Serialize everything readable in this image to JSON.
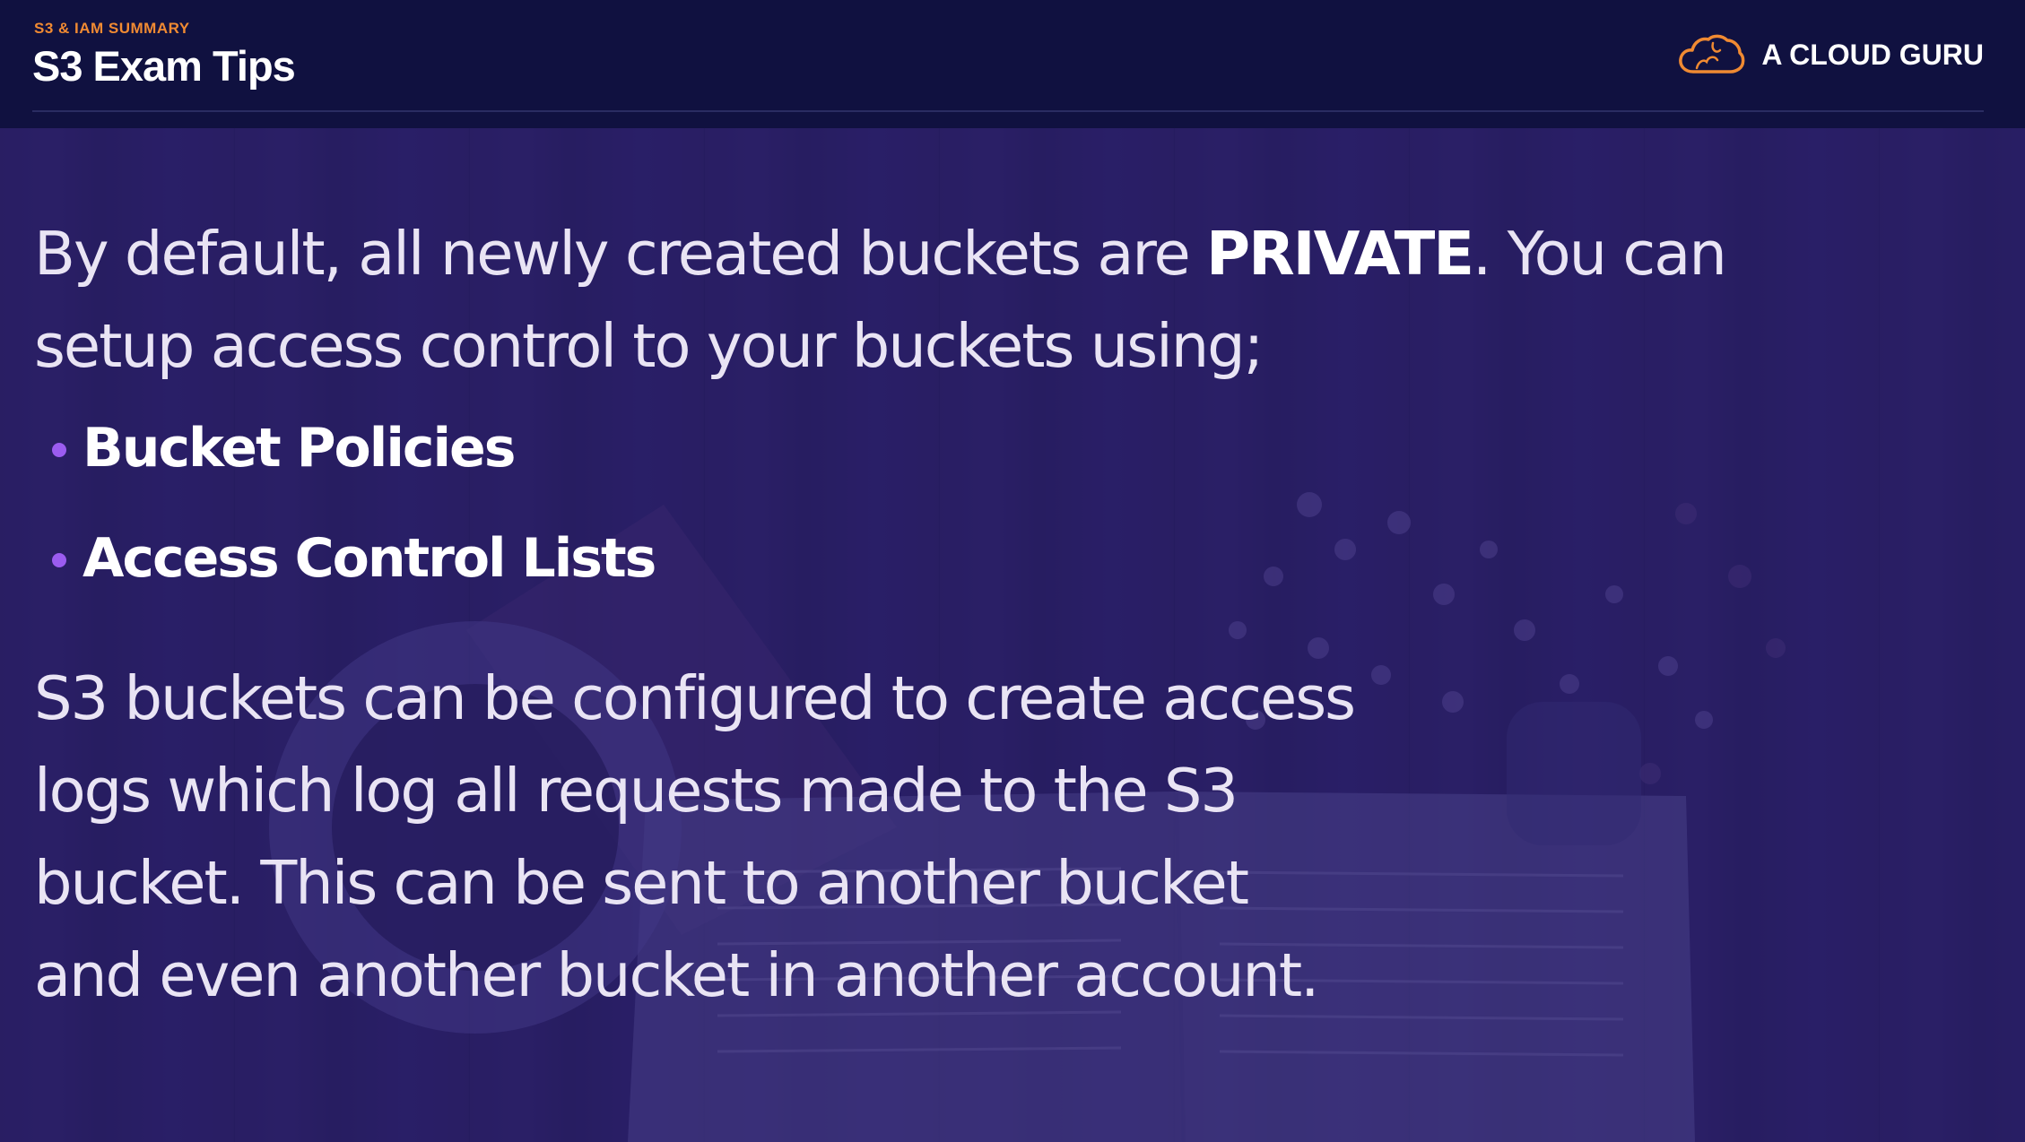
{
  "header": {
    "kicker": "S3 & IAM SUMMARY",
    "title": "S3 Exam Tips",
    "brand": {
      "name": "A CLOUD GURU",
      "logo_icon": "cloud-logo-icon",
      "logo_color": "#f08a32"
    }
  },
  "content": {
    "paragraph_1": {
      "before": "By default, all newly created buckets are ",
      "emphasis": "PRIVATE",
      "after": ". You can setup access control to your buckets using;"
    },
    "bullets": [
      {
        "label": "Bucket Policies"
      },
      {
        "label": "Access Control Lists"
      }
    ],
    "paragraph_2": "S3 buckets can be configured to create access logs which log all requests made to the S3 bucket. This can be sent to another bucket and even another bucket in another account."
  },
  "colors": {
    "header_bg": "#101140",
    "slide_overlay": "#281e6e",
    "kicker": "#f08a32",
    "bullet_dot": "#9b5cf0",
    "text": "#e9e4f4"
  }
}
